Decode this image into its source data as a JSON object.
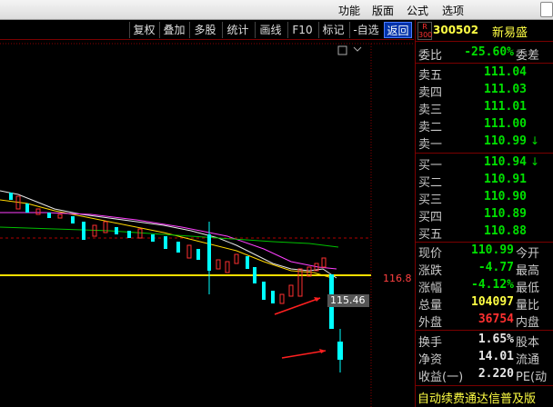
{
  "menu": {
    "items": [
      "功能",
      "版面",
      "公式",
      "选项"
    ]
  },
  "toolbar": {
    "buttons": [
      "复权",
      "叠加",
      "多股",
      "统计",
      "画线",
      "F10",
      "标记",
      "-自选",
      "返回"
    ]
  },
  "chart": {
    "price_level_label": "116.8",
    "cursor_price_label": "115.46"
  },
  "stock": {
    "badge": [
      "R",
      "300"
    ],
    "code": "300502",
    "name": "新易盛"
  },
  "quote": {
    "weibi": {
      "label": "委比",
      "value": "-25.60%",
      "extra": "委差"
    },
    "sell": [
      {
        "label": "卖五",
        "price": "111.04"
      },
      {
        "label": "卖四",
        "price": "111.03"
      },
      {
        "label": "卖三",
        "price": "111.01"
      },
      {
        "label": "卖二",
        "price": "111.00"
      },
      {
        "label": "卖一",
        "price": "110.99",
        "arrow": "↓"
      }
    ],
    "buy": [
      {
        "label": "买一",
        "price": "110.94",
        "arrow": "↓"
      },
      {
        "label": "买二",
        "price": "110.91"
      },
      {
        "label": "买三",
        "price": "110.90"
      },
      {
        "label": "买四",
        "price": "110.89"
      },
      {
        "label": "买五",
        "price": "110.88"
      }
    ],
    "stats": [
      {
        "label": "现价",
        "value": "110.99",
        "extra": "今开",
        "color": "green"
      },
      {
        "label": "涨跌",
        "value": "-4.77",
        "extra": "最高",
        "color": "green"
      },
      {
        "label": "涨幅",
        "value": "-4.12%",
        "extra": "最低",
        "color": "green"
      },
      {
        "label": "总量",
        "value": "104097",
        "extra": "量比",
        "color": "yellow"
      },
      {
        "label": "外盘",
        "value": "36754",
        "extra": "内盘",
        "color": "red"
      }
    ],
    "fund": [
      {
        "label": "换手",
        "value": "1.65%",
        "extra": "股本"
      },
      {
        "label": "净资",
        "value": "14.01",
        "extra": "流通"
      },
      {
        "label": "收益(一)",
        "value": "2.220",
        "extra": "PE(动"
      }
    ]
  },
  "news": {
    "text": "自动续费通达信普及版"
  }
}
